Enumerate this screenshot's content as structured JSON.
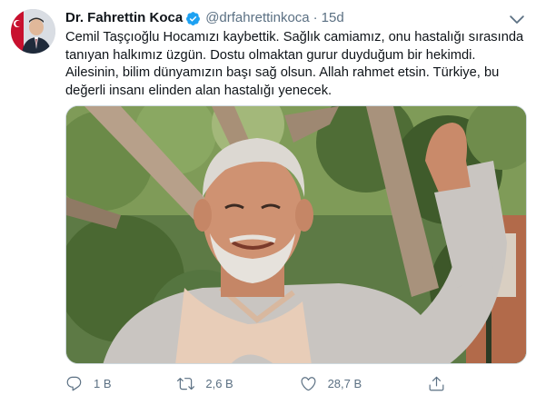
{
  "tweet": {
    "author_name": "Dr. Fahrettin Koca",
    "author_handle": "@drfahrettinkoca",
    "separator": "·",
    "time": "15d",
    "text": "Cemil Taşçıoğlu Hocamızı kaybettik. Sağlık camiamız, onu hastalığı sırasında\ntanıyan halkımız üzgün. Dostu olmaktan gurur duyduğum bir hekimdi.\nAilesinin, bilim dünyamızın başı sağ olsun. Allah rahmet etsin. Türkiye, bu\ndeğerli insanı elinden alan hastalığı yenecek.",
    "verified": true
  },
  "actions": {
    "reply_count": "1 B",
    "retweet_count": "2,6 B",
    "like_count": "28,7 B"
  },
  "icons": {
    "verified": "verified-badge-icon",
    "caret": "chevron-down-icon",
    "reply": "reply-icon",
    "retweet": "retweet-icon",
    "like": "heart-icon",
    "share": "share-icon"
  },
  "colors": {
    "accent": "#1da1f2",
    "muted": "#5b7083",
    "text": "#0f1419"
  }
}
